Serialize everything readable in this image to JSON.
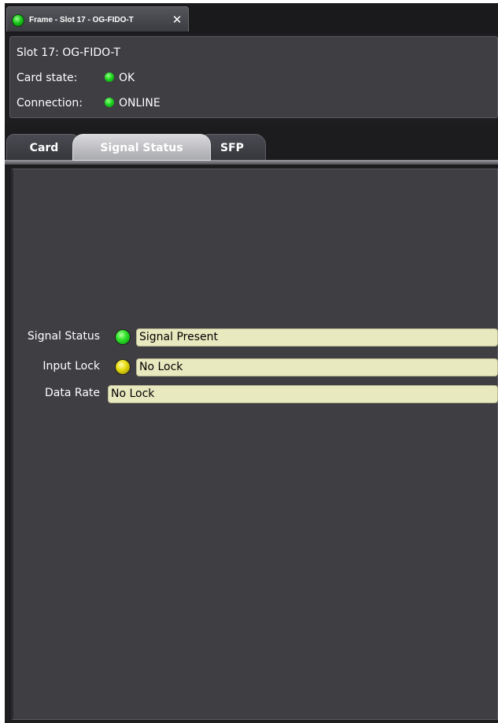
{
  "window": {
    "tab_title": "Frame - Slot 17 - OG-FIDO-T",
    "close_glyph": "✕",
    "status_led_color": "#18c51a"
  },
  "info": {
    "slot_line": "Slot 17: OG-FIDO-T",
    "card_state_label": "Card state:",
    "card_state_value": "OK",
    "connection_label": "Connection:",
    "connection_value": "ONLINE"
  },
  "tabs": [
    {
      "label": "Card",
      "selected": false
    },
    {
      "label": "Signal Status",
      "selected": true
    },
    {
      "label": "SFP",
      "selected": false
    }
  ],
  "signal_panel": {
    "rows": [
      {
        "label": "Signal Status",
        "led": "green",
        "value": "Signal Present"
      },
      {
        "label": "Input Lock",
        "led": "yellow",
        "value": "No Lock"
      },
      {
        "label": "Data Rate",
        "led": null,
        "value": "No Lock"
      }
    ]
  },
  "colors": {
    "led_green": "#2ee32a",
    "led_yellow": "#e8dc10",
    "field_bg": "#e9e9c0",
    "panel_bg": "#3e3e43"
  }
}
